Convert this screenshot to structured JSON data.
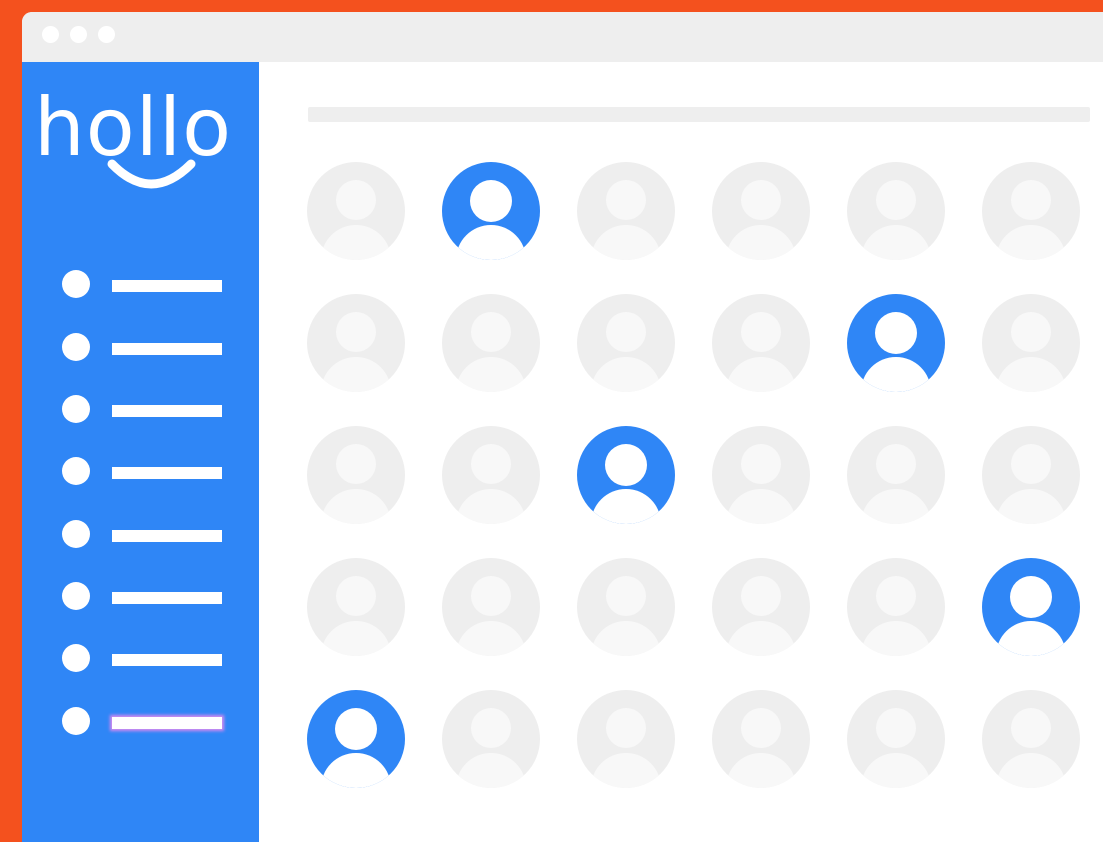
{
  "app": {
    "logo_text": "hollo"
  },
  "colors": {
    "background": "#F4511E",
    "brand_blue": "#2F86F6",
    "placeholder_gray": "#EEEEEE",
    "white": "#FFFFFF"
  },
  "window_controls": [
    "window-dot-1",
    "window-dot-2",
    "window-dot-3"
  ],
  "sidebar": {
    "items": [
      {
        "icon": "bullet-icon",
        "active": false
      },
      {
        "icon": "bullet-icon",
        "active": false
      },
      {
        "icon": "bullet-icon",
        "active": false
      },
      {
        "icon": "bullet-icon",
        "active": false
      },
      {
        "icon": "bullet-icon",
        "active": false
      },
      {
        "icon": "bullet-icon",
        "active": false
      },
      {
        "icon": "bullet-icon",
        "active": false
      },
      {
        "icon": "bullet-icon",
        "active": true
      }
    ]
  },
  "grid": {
    "rows": 5,
    "cols": 6,
    "icon": "user-avatar-icon",
    "highlighted": [
      [
        0,
        1
      ],
      [
        1,
        4
      ],
      [
        2,
        2
      ],
      [
        3,
        5
      ],
      [
        4,
        0
      ]
    ]
  }
}
